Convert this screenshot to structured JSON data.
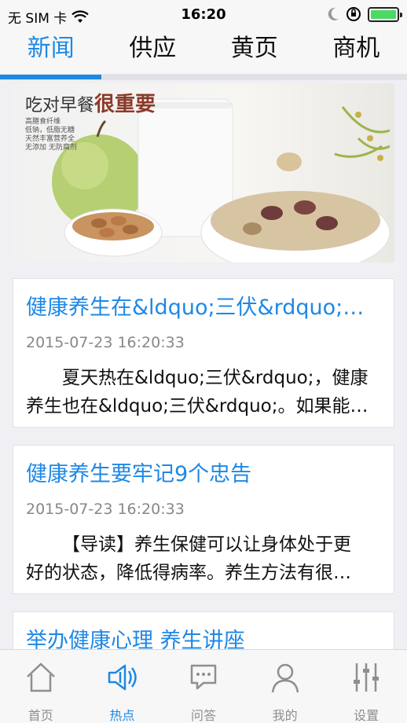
{
  "status": {
    "carrier": "无 SIM 卡",
    "time": "16:20"
  },
  "tabs": [
    {
      "label": "新闻",
      "active": true
    },
    {
      "label": "供应",
      "active": false
    },
    {
      "label": "黄页",
      "active": false
    },
    {
      "label": "商机",
      "active": false
    }
  ],
  "banner": {
    "title_a": "吃对早餐",
    "title_b": "很重要",
    "lines": [
      "高膳食纤维",
      "低钠，低脂无糖",
      "天然丰富营养全",
      "无添加 无防腐剂"
    ]
  },
  "articles": [
    {
      "title": "健康养生在&ldquo;三伏&rdquo;…",
      "date": "2015-07-23 16:20:33",
      "line1": "夏天热在&ldquo;三伏&rdquo;，健康",
      "line2": "养生也在&ldquo;三伏&rdquo;。如果能…"
    },
    {
      "title": "健康养生要牢记9个忠告",
      "date": "2015-07-23 16:20:33",
      "line1": "【导读】养生保健可以让身体处于更",
      "line2": "好的状态，降低得病率。养生方法有很…"
    },
    {
      "title": "举办健康心理 养生讲座"
    }
  ],
  "bottom_tabs": [
    {
      "label": "首页",
      "icon": "home-icon"
    },
    {
      "label": "热点",
      "icon": "hot-icon",
      "active": true
    },
    {
      "label": "问答",
      "icon": "chat-icon"
    },
    {
      "label": "我的",
      "icon": "user-icon"
    },
    {
      "label": "设置",
      "icon": "settings-sliders-icon"
    }
  ],
  "colors": {
    "accent": "#1e88e5",
    "inactive": "#8e8e93"
  }
}
